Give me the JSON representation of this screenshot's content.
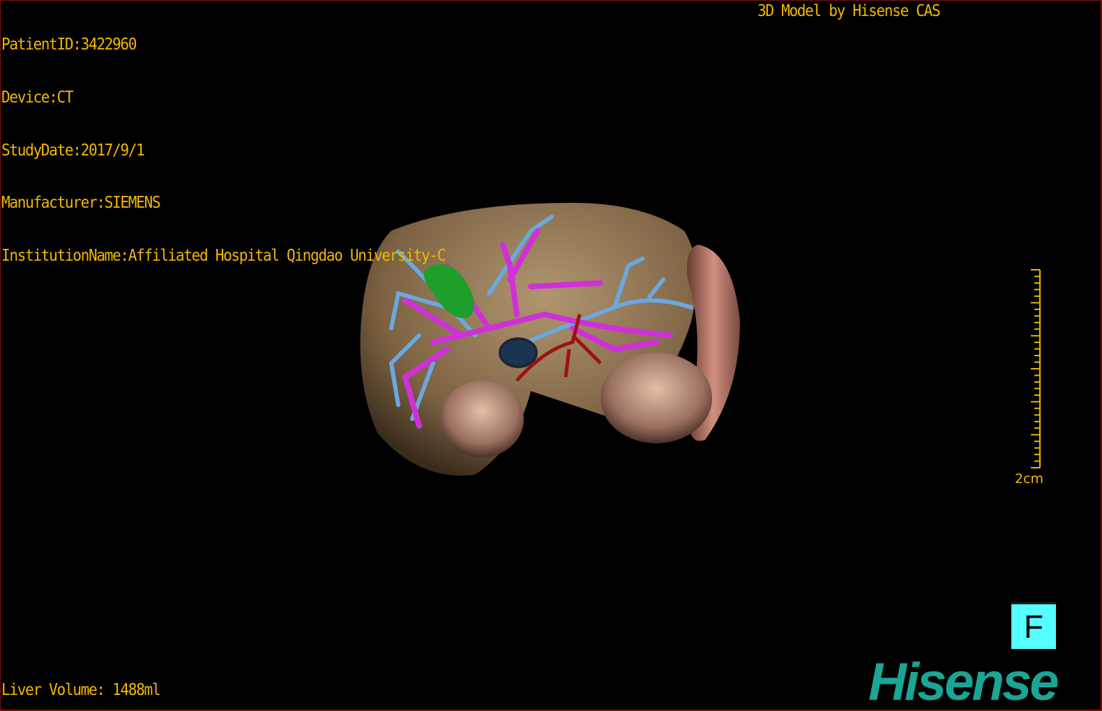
{
  "patient_info": {
    "patient_id": "PatientID:3422960",
    "device": "Device:CT",
    "study_date": "StudyDate:2017/9/1",
    "manufacturer": "Manufacturer:SIEMENS",
    "institution": "InstitutionName:Affiliated Hospital Qingdao University-C"
  },
  "credit": "3D Model by Hisense CAS",
  "liver_volume": "Liver Volume: 1488ml",
  "scale_bar": {
    "label": "2cm"
  },
  "orientation": {
    "label": "F"
  },
  "logo": "Hisense",
  "colors": {
    "text": "#f0b800",
    "liver": "#8a6d45",
    "portal_vein": "#d030d8",
    "hepatic_vein": "#6aa8e0",
    "artery": "#a01010",
    "gallbladder": "#1e9e2a",
    "kidney": "#b88a78",
    "orientation_box": "#55ffff",
    "logo": "#1aa594"
  }
}
